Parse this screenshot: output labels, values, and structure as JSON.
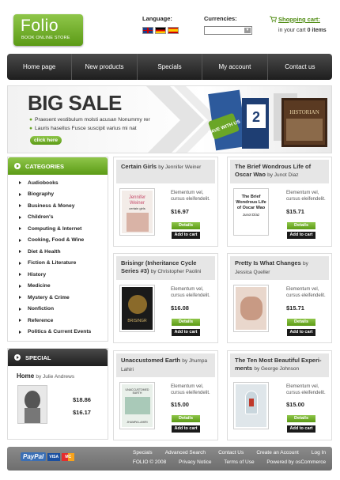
{
  "header": {
    "logo_name": "Folio",
    "logo_tagline": "BOOK ONLINE STORE",
    "language_label": "Language:",
    "currencies_label": "Currencies:",
    "currency_value": "",
    "cart_link": "Shopping cart:",
    "cart_info_prefix": "in your cart",
    "cart_info_count": "0 items"
  },
  "nav": {
    "items": [
      "Home page",
      "New products",
      "Specials",
      "My account",
      "Contact us"
    ]
  },
  "banner": {
    "title": "BIG SALE",
    "bullet1": "Praesent vestibulum molsti acusan Nonummy rer",
    "bullet2": "Lauris  hasellus  Fusce suscipit varius mi nat",
    "cta": "click here",
    "save_badge": "SAVE WITH US",
    "art_book_label": "HISTORIAN"
  },
  "categories": {
    "heading": "CATEGORIES",
    "items": [
      "Audiobooks",
      "Biography",
      "Business & Money",
      "Children's",
      "Computing & Internet",
      "Cooking, Food & Wine",
      "Diet & Health",
      "Fiction & Literature",
      "History",
      "Medicine",
      "Mystery & Crime",
      "Nonfiction",
      "Reference",
      "Politics & Current Events"
    ]
  },
  "special": {
    "heading": "SPECIAL",
    "title": "Home",
    "by": "by Julie Andrews",
    "old_price": "$18.86",
    "new_price": "$16.17"
  },
  "products": [
    {
      "title": "Certain Girls",
      "by": "by Jennifer Weiner",
      "desc1": "Elementum vel,",
      "desc2": "cursus eleifendelit.",
      "price": "$16.97",
      "details": "Details",
      "add": "Add to cart",
      "cover_text": "Jennifer Weiner",
      "cover_sub": "certain girls",
      "color": "#e8c9c1"
    },
    {
      "title": "The Brief Wondrous Life of Oscar Wao",
      "by": "by Junot Diaz",
      "desc1": "Elementum vel,",
      "desc2": "cursus eleifendelit.",
      "price": "$15.71",
      "details": "Details",
      "add": "Add to cart",
      "cover_text": "The Brief Wondrous Life of Oscar Wao",
      "cover_sub": "Junot Díaz",
      "color": "#ffffff"
    },
    {
      "title": "Brisingr (Inheritance Cycle Series #3)",
      "by": "by Christopher Paolini",
      "desc1": "Elementum vel,",
      "desc2": "cursus eleifendelit.",
      "price": "$16.08",
      "details": "Details",
      "add": "Add to cart",
      "cover_text": "BRISINGR",
      "cover_sub": "",
      "color": "#1a1a1a"
    },
    {
      "title": "Pretty Is What Changes",
      "by": "by Jessica Queller",
      "desc1": "Elementum vel,",
      "desc2": "cursus eleifendelit.",
      "price": "$15.71",
      "details": "Details",
      "add": "Add to cart",
      "cover_text": "",
      "cover_sub": "",
      "color": "#d9b8a8"
    },
    {
      "title": "Unaccustomed Earth",
      "by": "by Jhumpa Lahiri",
      "desc1": "Elementum vel,",
      "desc2": "cursus eleifendelit.",
      "price": "$15.00",
      "details": "Details",
      "add": "Add to cart",
      "cover_text": "UNACCUSTOMED EARTH",
      "cover_sub": "JHUMPA LAHIRI",
      "color": "#cfe0d6"
    },
    {
      "title": "The Ten Most Beautiful Experi-ments",
      "by": "by George Johnson",
      "desc1": "Elementum vel,",
      "desc2": "cursus eleifendelit.",
      "price": "$15.00",
      "details": "Details",
      "add": "Add to cart",
      "cover_text": "",
      "cover_sub": "",
      "color": "#cfd9df"
    }
  ],
  "footer": {
    "paypal": "PayPal",
    "visa": "VISA",
    "mastercard": "MC",
    "links1": [
      "Specials",
      "Advanced Search",
      "Contact Us",
      "Create an Account",
      "Log In"
    ],
    "links2": [
      "FOLIO © 2008",
      "Privacy Notice",
      "Terms of Use",
      "Powered by osCommerce"
    ]
  }
}
